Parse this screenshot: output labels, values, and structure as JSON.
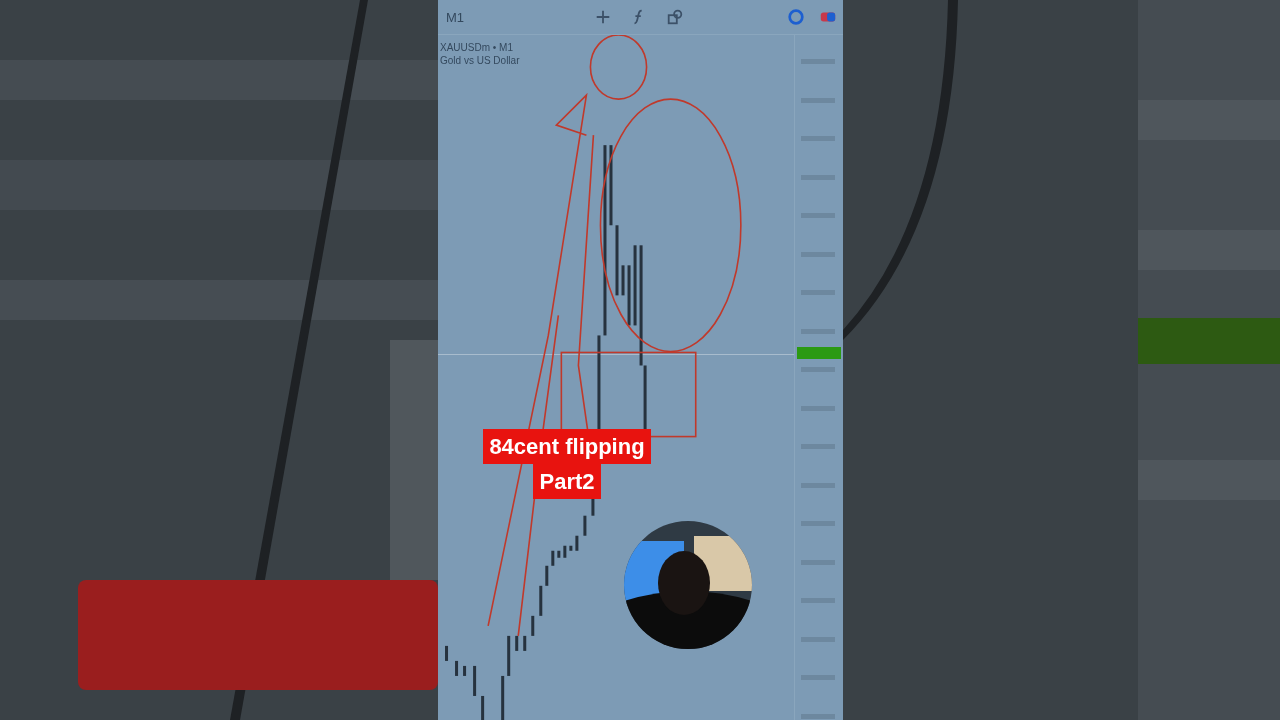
{
  "top_bar": {
    "timeframe": "M1"
  },
  "chart": {
    "symbol": "XAUUSDm • M1",
    "description": "Gold vs US Dollar"
  },
  "caption": [
    "84cent flipping",
    "Part2"
  ]
}
